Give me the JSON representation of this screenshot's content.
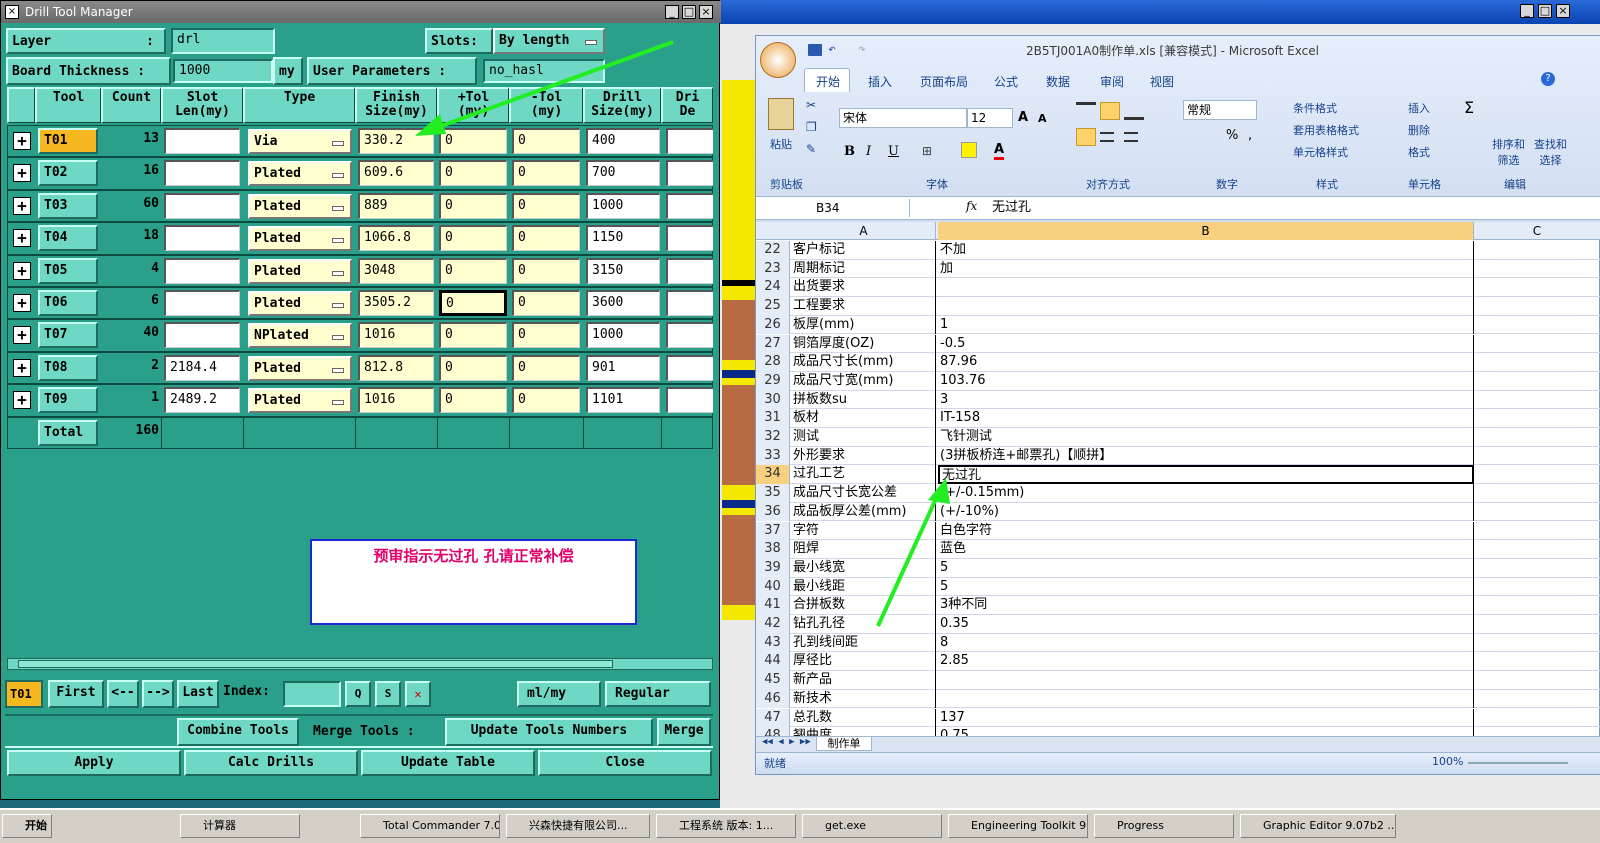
{
  "drill_window": {
    "title": "Drill Tool Manager",
    "layer_label": "Layer",
    "layer_value": "drl",
    "slots_label": "Slots:",
    "slots_value": "By length",
    "thickness_label": "Board Thickness :",
    "thickness_value": "1000",
    "thickness_unit": "my",
    "user_params_label": "User Parameters :",
    "user_params_value": "no_hasl",
    "columns": [
      "Tool",
      "Count",
      "Slot\nLen(my)",
      "Type",
      "Finish\nSize(my)",
      "+Tol\n(my)",
      "-Tol\n(my)",
      "Drill\nSize(my)",
      "Dri\nDe"
    ],
    "rows": [
      {
        "tool": "T01",
        "count": "13",
        "slot": "",
        "type": "Via",
        "finish": "330.2",
        "ptol": "0",
        "ntol": "0",
        "drill": "400"
      },
      {
        "tool": "T02",
        "count": "16",
        "slot": "",
        "type": "Plated",
        "finish": "609.6",
        "ptol": "0",
        "ntol": "0",
        "drill": "700"
      },
      {
        "tool": "T03",
        "count": "60",
        "slot": "",
        "type": "Plated",
        "finish": "889",
        "ptol": "0",
        "ntol": "0",
        "drill": "1000"
      },
      {
        "tool": "T04",
        "count": "18",
        "slot": "",
        "type": "Plated",
        "finish": "1066.8",
        "ptol": "0",
        "ntol": "0",
        "drill": "1150"
      },
      {
        "tool": "T05",
        "count": "4",
        "slot": "",
        "type": "Plated",
        "finish": "3048",
        "ptol": "0",
        "ntol": "0",
        "drill": "3150"
      },
      {
        "tool": "T06",
        "count": "6",
        "slot": "",
        "type": "Plated",
        "finish": "3505.2",
        "ptol": "0",
        "ntol": "0",
        "drill": "3600"
      },
      {
        "tool": "T07",
        "count": "40",
        "slot": "",
        "type": "NPlated",
        "finish": "1016",
        "ptol": "0",
        "ntol": "0",
        "drill": "1000"
      },
      {
        "tool": "T08",
        "count": "2",
        "slot": "2184.4",
        "type": "Plated",
        "finish": "812.8",
        "ptol": "0",
        "ntol": "0",
        "drill": "901"
      },
      {
        "tool": "T09",
        "count": "1",
        "slot": "2489.2",
        "type": "Plated",
        "finish": "1016",
        "ptol": "0",
        "ntol": "0",
        "drill": "1101"
      }
    ],
    "total_label": "Total",
    "total_value": "160",
    "annotation": "预审指示无过孔   孔请正常补偿",
    "nav": {
      "current": "T01",
      "first": "First",
      "prev": "<--",
      "next": "-->",
      "last": "Last",
      "index_label": "Index:",
      "units": "ml/my",
      "mode": "Regular"
    },
    "tools_row": {
      "combine": "Combine Tools",
      "merge_label": "Merge Tools :",
      "update_numbers": "Update Tools Numbers",
      "merge": "Merge"
    },
    "bottom": {
      "apply": "Apply",
      "calc": "Calc Drills",
      "update_table": "Update Table",
      "close": "Close"
    }
  },
  "excel": {
    "title": "2B5TJ001A0制作单.xls [兼容模式] - Microsoft Excel",
    "tabs": [
      "开始",
      "插入",
      "页面布局",
      "公式",
      "数据",
      "审阅",
      "视图"
    ],
    "font_name": "宋体",
    "font_size": "12",
    "number_format": "常规",
    "ribbon": {
      "paste": "粘贴",
      "clipboard": "剪贴板",
      "font": "字体",
      "alignment": "对齐方式",
      "number": "数字",
      "styles": "样式",
      "cells": "单元格",
      "editing": "编辑",
      "cond_format": "条件格式",
      "table_format": "套用表格格式",
      "cell_style": "单元格样式",
      "insert": "插入",
      "delete": "删除",
      "format": "格式",
      "sort": "排序和\n筛选",
      "find": "查找和\n选择"
    },
    "name_box": "B34",
    "formula": "无过孔",
    "col_headers": [
      "A",
      "B",
      "C"
    ],
    "rows": [
      {
        "n": "22",
        "a": "客户标记",
        "b": "不加"
      },
      {
        "n": "23",
        "a": "周期标记",
        "b": "加"
      },
      {
        "n": "24",
        "a": "出货要求",
        "b": ""
      },
      {
        "n": "25",
        "a": "工程要求",
        "b": ""
      },
      {
        "n": "26",
        "a": "板厚(mm)",
        "b": "1"
      },
      {
        "n": "27",
        "a": "铜箔厚度(OZ)",
        "b": "-0.5"
      },
      {
        "n": "28",
        "a": "成品尺寸长(mm)",
        "b": "87.96"
      },
      {
        "n": "29",
        "a": "成品尺寸宽(mm)",
        "b": "103.76"
      },
      {
        "n": "30",
        "a": "拼板数su",
        "b": "3"
      },
      {
        "n": "31",
        "a": "板材",
        "b": "IT-158"
      },
      {
        "n": "32",
        "a": "测试",
        "b": "飞针测试"
      },
      {
        "n": "33",
        "a": "外形要求",
        "b": "(3拼板桥连+邮票孔)【顺拼】"
      },
      {
        "n": "34",
        "a": "过孔工艺",
        "b": "无过孔"
      },
      {
        "n": "35",
        "a": "成品尺寸长宽公差",
        "b": "(+/-0.15mm)"
      },
      {
        "n": "36",
        "a": "成品板厚公差(mm)",
        "b": "(+/-10%)"
      },
      {
        "n": "37",
        "a": "字符",
        "b": "白色字符"
      },
      {
        "n": "38",
        "a": "阻焊",
        "b": "蓝色"
      },
      {
        "n": "39",
        "a": "最小线宽",
        "b": "5"
      },
      {
        "n": "40",
        "a": "最小线距",
        "b": "5"
      },
      {
        "n": "41",
        "a": "合拼板数",
        "b": "3种不同"
      },
      {
        "n": "42",
        "a": "钻孔孔径",
        "b": "0.35"
      },
      {
        "n": "43",
        "a": "孔到线间距",
        "b": "8"
      },
      {
        "n": "44",
        "a": "厚径比",
        "b": "2.85"
      },
      {
        "n": "45",
        "a": "新产品",
        "b": ""
      },
      {
        "n": "46",
        "a": "新技术",
        "b": ""
      },
      {
        "n": "47",
        "a": "总孔数",
        "b": "137"
      },
      {
        "n": "48",
        "a": "翘曲度",
        "b": "0.75"
      }
    ],
    "sheet_tab": "制作单",
    "status": "就绪",
    "zoom": "100%"
  },
  "taskbar": {
    "start": "开始",
    "items": [
      "计算器",
      "Total Commander 7.0 ...",
      "兴森快捷有限公司...",
      "工程系统  版本: 1...",
      "get.exe",
      "Engineering Toolkit 9....",
      "Progress",
      "Graphic Editor 9.07b2 ..."
    ]
  },
  "colors": {
    "dialog_bg": "#2aa08a",
    "highlight_tool": "#f5b820",
    "arrow": "#22ee22",
    "annotation": "#e0006a"
  }
}
